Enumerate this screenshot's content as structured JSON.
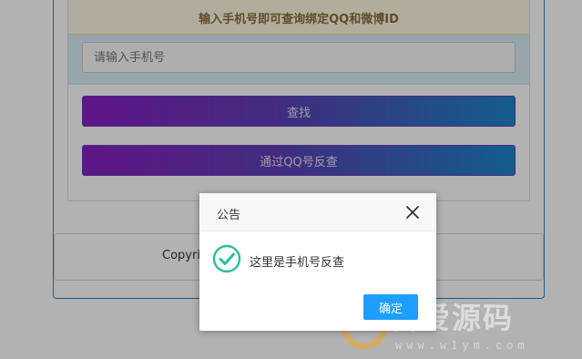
{
  "page": {
    "notice_text": "输入手机号即可查询绑定QQ和微博ID",
    "phone_input": {
      "placeholder": "请输入手机号",
      "value": ""
    },
    "find_button_label": "查找",
    "reverse_button_label": "通过QQ号反查",
    "footer_text": "Copyri"
  },
  "dialog": {
    "title": "公告",
    "message": "这里是手机号反查",
    "ok_label": "确定",
    "icons": {
      "close": "close-icon",
      "status": "success-check-icon"
    }
  },
  "watermark": {
    "text": "吾爱源码",
    "url": "www.w1ym.com"
  },
  "colors": {
    "outer_border": "#2c86c8",
    "notice_bg": "#fcf8e3",
    "notice_text": "#8a6d3b",
    "input_zone_bg": "#d9edf7",
    "button_gradient_start": "#8a1fc2",
    "button_gradient_end": "#1d86c9",
    "dialog_ok_bg": "#1e9fff",
    "success_icon": "#2bbf9a"
  }
}
